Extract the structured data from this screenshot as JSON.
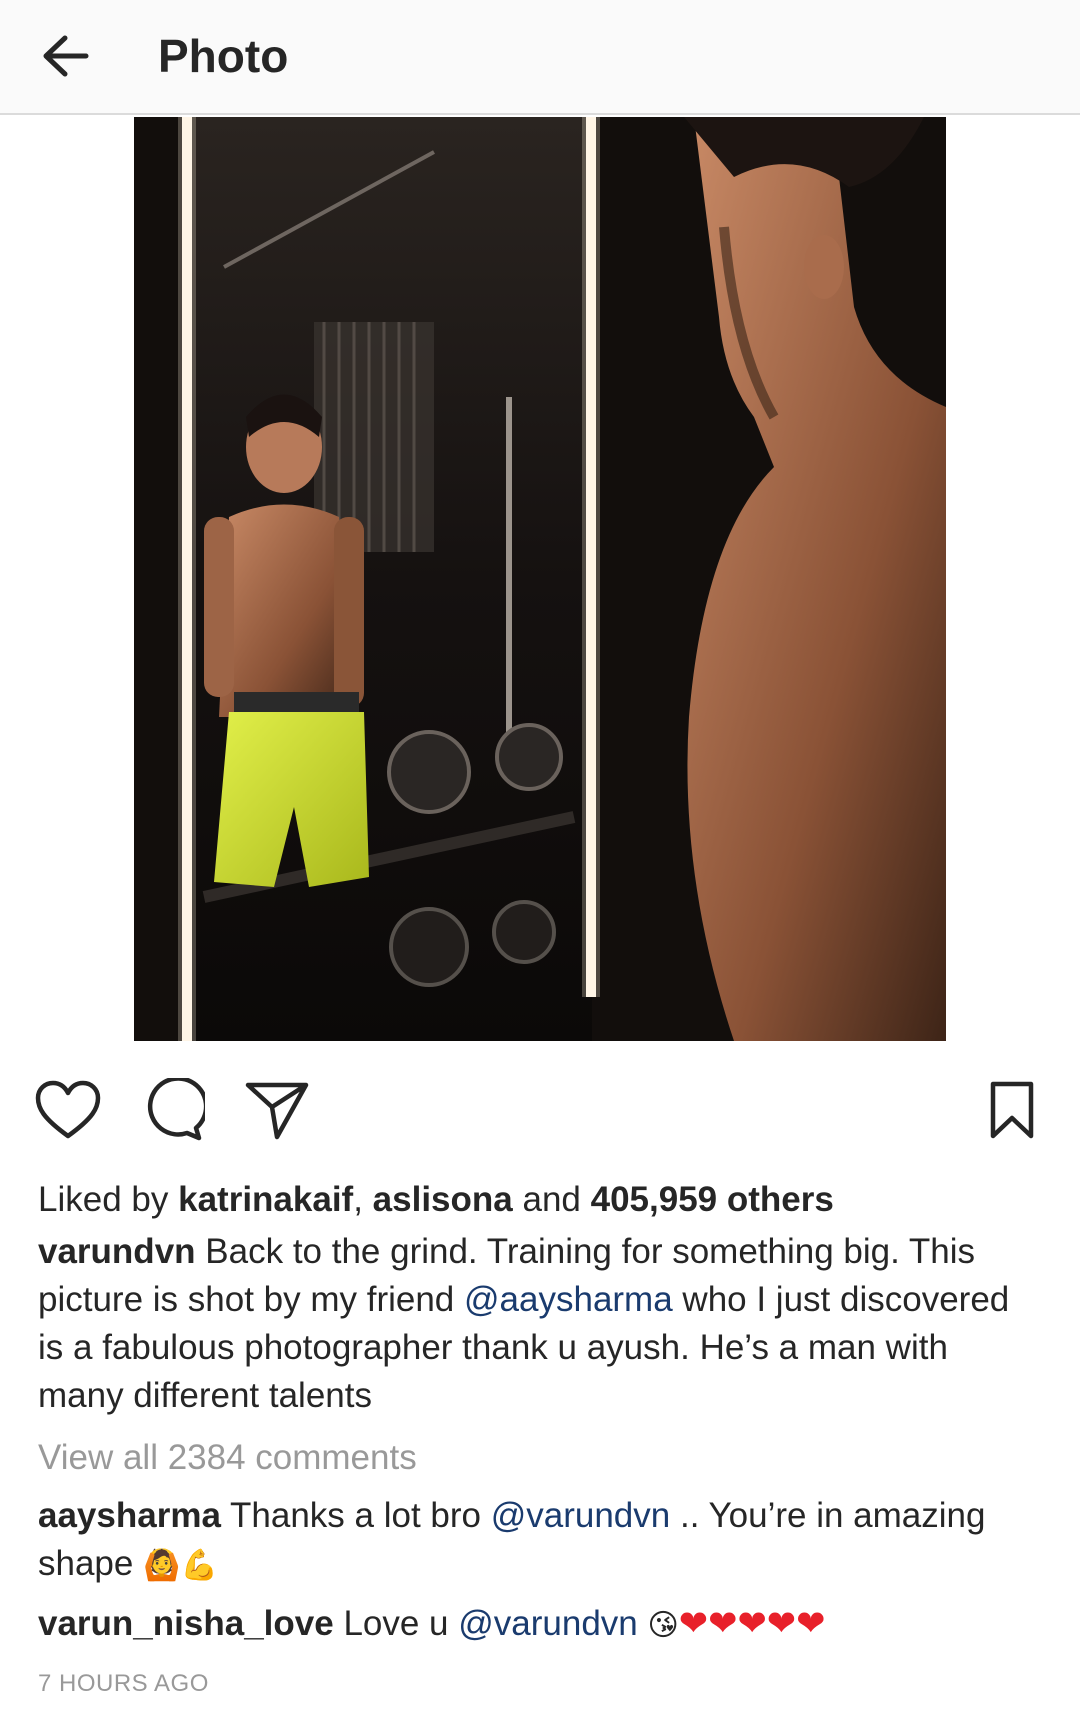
{
  "header": {
    "title": "Photo",
    "back_icon": "arrow-left-icon"
  },
  "post": {
    "photo_alt": "Man shirtless looking into a gym mirror",
    "actions": {
      "like_icon": "heart-outline-icon",
      "comment_icon": "comment-bubble-icon",
      "share_icon": "paper-plane-icon",
      "save_icon": "bookmark-icon"
    },
    "likes": {
      "prefix": "Liked by",
      "user1": "katrinakaif",
      "sep": ",",
      "user2": "aslisona",
      "and": "and",
      "others": "405,959 others"
    },
    "caption": {
      "author": "varundvn",
      "text1": "Back to the grind. Training for something big. This picture is shot by my friend",
      "mention": "@aaysharma",
      "text2": "who I just discovered is a fabulous photographer thank u ayush. He’s a man with many different talents"
    },
    "view_all": "View all 2384 comments",
    "comments": [
      {
        "author": "aaysharma",
        "text1": "Thanks a lot bro",
        "mention": "@varundvn",
        "text2": ".. You’re in amazing shape",
        "emoji": "🙆💪"
      },
      {
        "author": "varun_nisha_love",
        "text1": "Love u",
        "mention": "@varundvn",
        "emoji": "😘",
        "hearts": "❤❤❤❤❤"
      }
    ],
    "time": "7 HOURS AGO"
  }
}
